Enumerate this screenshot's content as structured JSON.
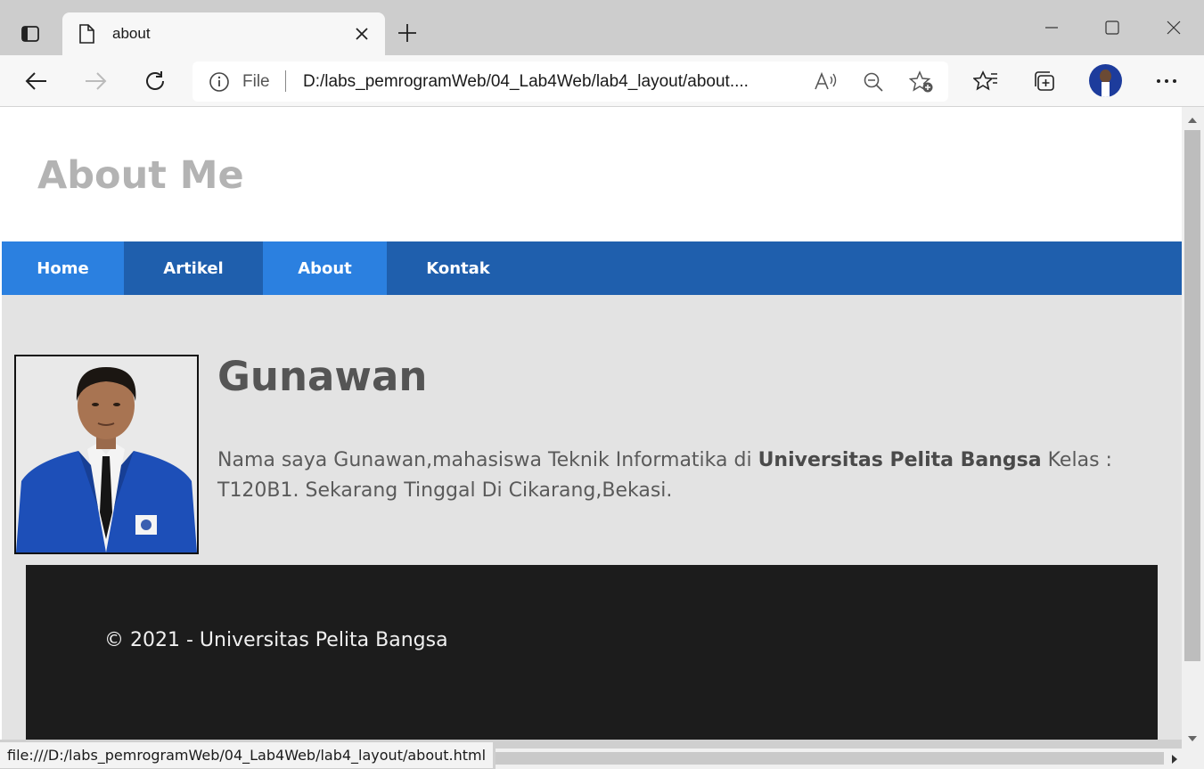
{
  "browser": {
    "tab_title": "about",
    "address_prefix": "File",
    "url": "D:/labs_pemrogramWeb/04_Lab4Web/lab4_layout/about....",
    "status_url": "file:///D:/labs_pemrogramWeb/04_Lab4Web/lab4_layout/about.html"
  },
  "page": {
    "header_title": "About Me",
    "nav": [
      {
        "label": "Home"
      },
      {
        "label": "Artikel"
      },
      {
        "label": "About"
      },
      {
        "label": "Kontak"
      }
    ],
    "name": "Gunawan",
    "bio_text_1": "Nama saya Gunawan,mahasiswa Teknik Informatika di ",
    "bio_bold": "Universitas Pelita Bangsa",
    "bio_text_2": " Kelas : T120B1. Sekarang Tinggal Di Cikarang,Bekasi.",
    "footer": "© 2021 - Universitas Pelita Bangsa"
  },
  "colors": {
    "nav_dark": "#1f5fad",
    "nav_light": "#2b80e0",
    "footer_bg": "#1c1c1c",
    "content_bg": "#e3e3e3"
  }
}
